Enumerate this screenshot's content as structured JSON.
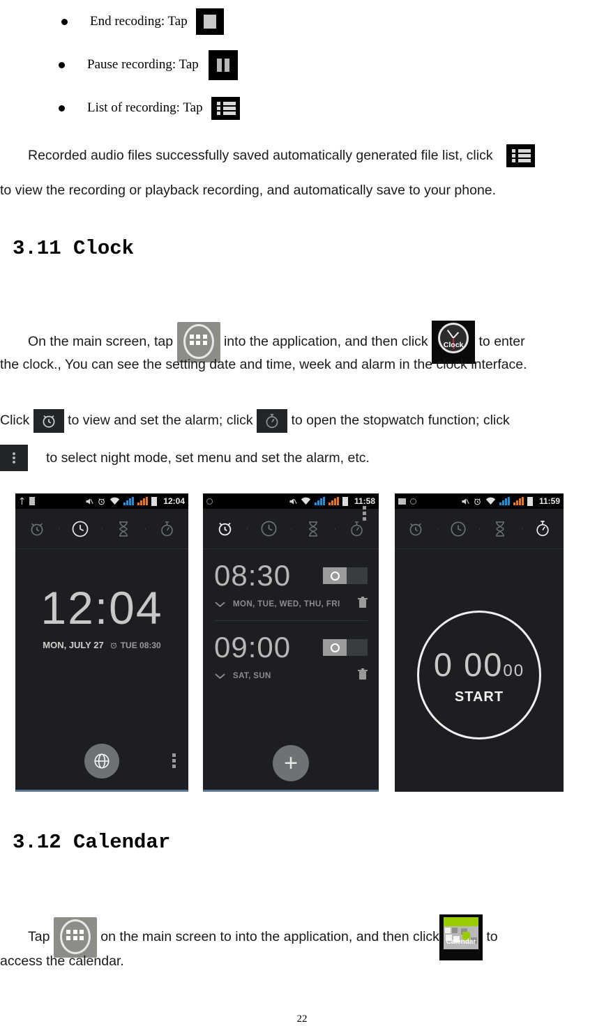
{
  "bullets": [
    {
      "label": "End recoding: Tap",
      "icon": "stop-icon"
    },
    {
      "label": "Pause recording: Tap",
      "icon": "pause-icon"
    },
    {
      "label": "List of recording: Tap",
      "icon": "list-icon"
    }
  ],
  "paragraphs": {
    "recording_note_a": "Recorded audio files successfully saved automatically generated file list, click",
    "recording_note_b": "to view the recording or playback recording, and automatically save to your phone.",
    "clock_p1_a": "On the main screen, tap",
    "clock_p1_b": "into the application, and then click",
    "clock_p1_c": "to enter",
    "clock_p2": "the clock., You can see the setting date and time, week and alarm in the clock interface.",
    "clock_p3_a": "Click",
    "clock_p3_b": "to view and set the alarm; click",
    "clock_p3_c": "to open the stopwatch function; click",
    "clock_p4": "to select night mode, set menu and set the alarm, etc.",
    "calendar_p_a": "Tap",
    "calendar_p_b": "on the main screen to into the application, and then click",
    "calendar_p_c": "to",
    "calendar_p2": "access the calendar."
  },
  "headings": {
    "clock": "3.11 Clock",
    "calendar": "3.12 Calendar"
  },
  "icons": {
    "clock_app_label": "Clock",
    "calendar_app_label": "Calendar"
  },
  "screenshots": [
    {
      "name": "clock-home-screen",
      "status": {
        "time": "12:04",
        "icons": [
          "usb-icon",
          "sim-icon",
          "mute-icon",
          "alarm-icon",
          "wifi-icon",
          "signal-icon",
          "signal-icon",
          "battery-icon"
        ]
      },
      "tabs": [
        "alarm-tab-icon",
        "clock-tab-icon",
        "timer-tab-icon",
        "stopwatch-tab-icon"
      ],
      "active_tab": 1,
      "big_time": "12:04",
      "date": "MON, JULY 27",
      "next_alarm": "TUE 08:30",
      "bottom": {
        "globe": "world-clock-icon",
        "overflow": "overflow-menu-icon"
      }
    },
    {
      "name": "alarm-list-screen",
      "status": {
        "time": "11:58",
        "icons": [
          "sim-icon",
          "mute-icon",
          "wifi-icon",
          "signal-icon",
          "signal-icon",
          "battery-icon"
        ]
      },
      "tabs": [
        "alarm-tab-icon",
        "clock-tab-icon",
        "timer-tab-icon",
        "stopwatch-tab-icon"
      ],
      "active_tab": 0,
      "alarms": [
        {
          "time": "08:30",
          "days": "MON, TUE, WED, THU, FRI",
          "enabled": true
        },
        {
          "time": "09:00",
          "days": "SAT, SUN",
          "enabled": true
        }
      ],
      "add_label": "+",
      "bottom": {
        "overflow": "overflow-menu-icon"
      }
    },
    {
      "name": "stopwatch-screen",
      "status": {
        "time": "11:59",
        "icons": [
          "sd-icon",
          "sim-icon",
          "mute-icon",
          "alarm-icon",
          "wifi-icon",
          "signal-icon",
          "signal-icon",
          "battery-icon"
        ]
      },
      "tabs": [
        "alarm-tab-icon",
        "clock-tab-icon",
        "timer-tab-icon",
        "stopwatch-tab-icon"
      ],
      "active_tab": 3,
      "digits": "0 00",
      "digits_small": "00",
      "start_label": "START"
    }
  ],
  "page_number": "22"
}
